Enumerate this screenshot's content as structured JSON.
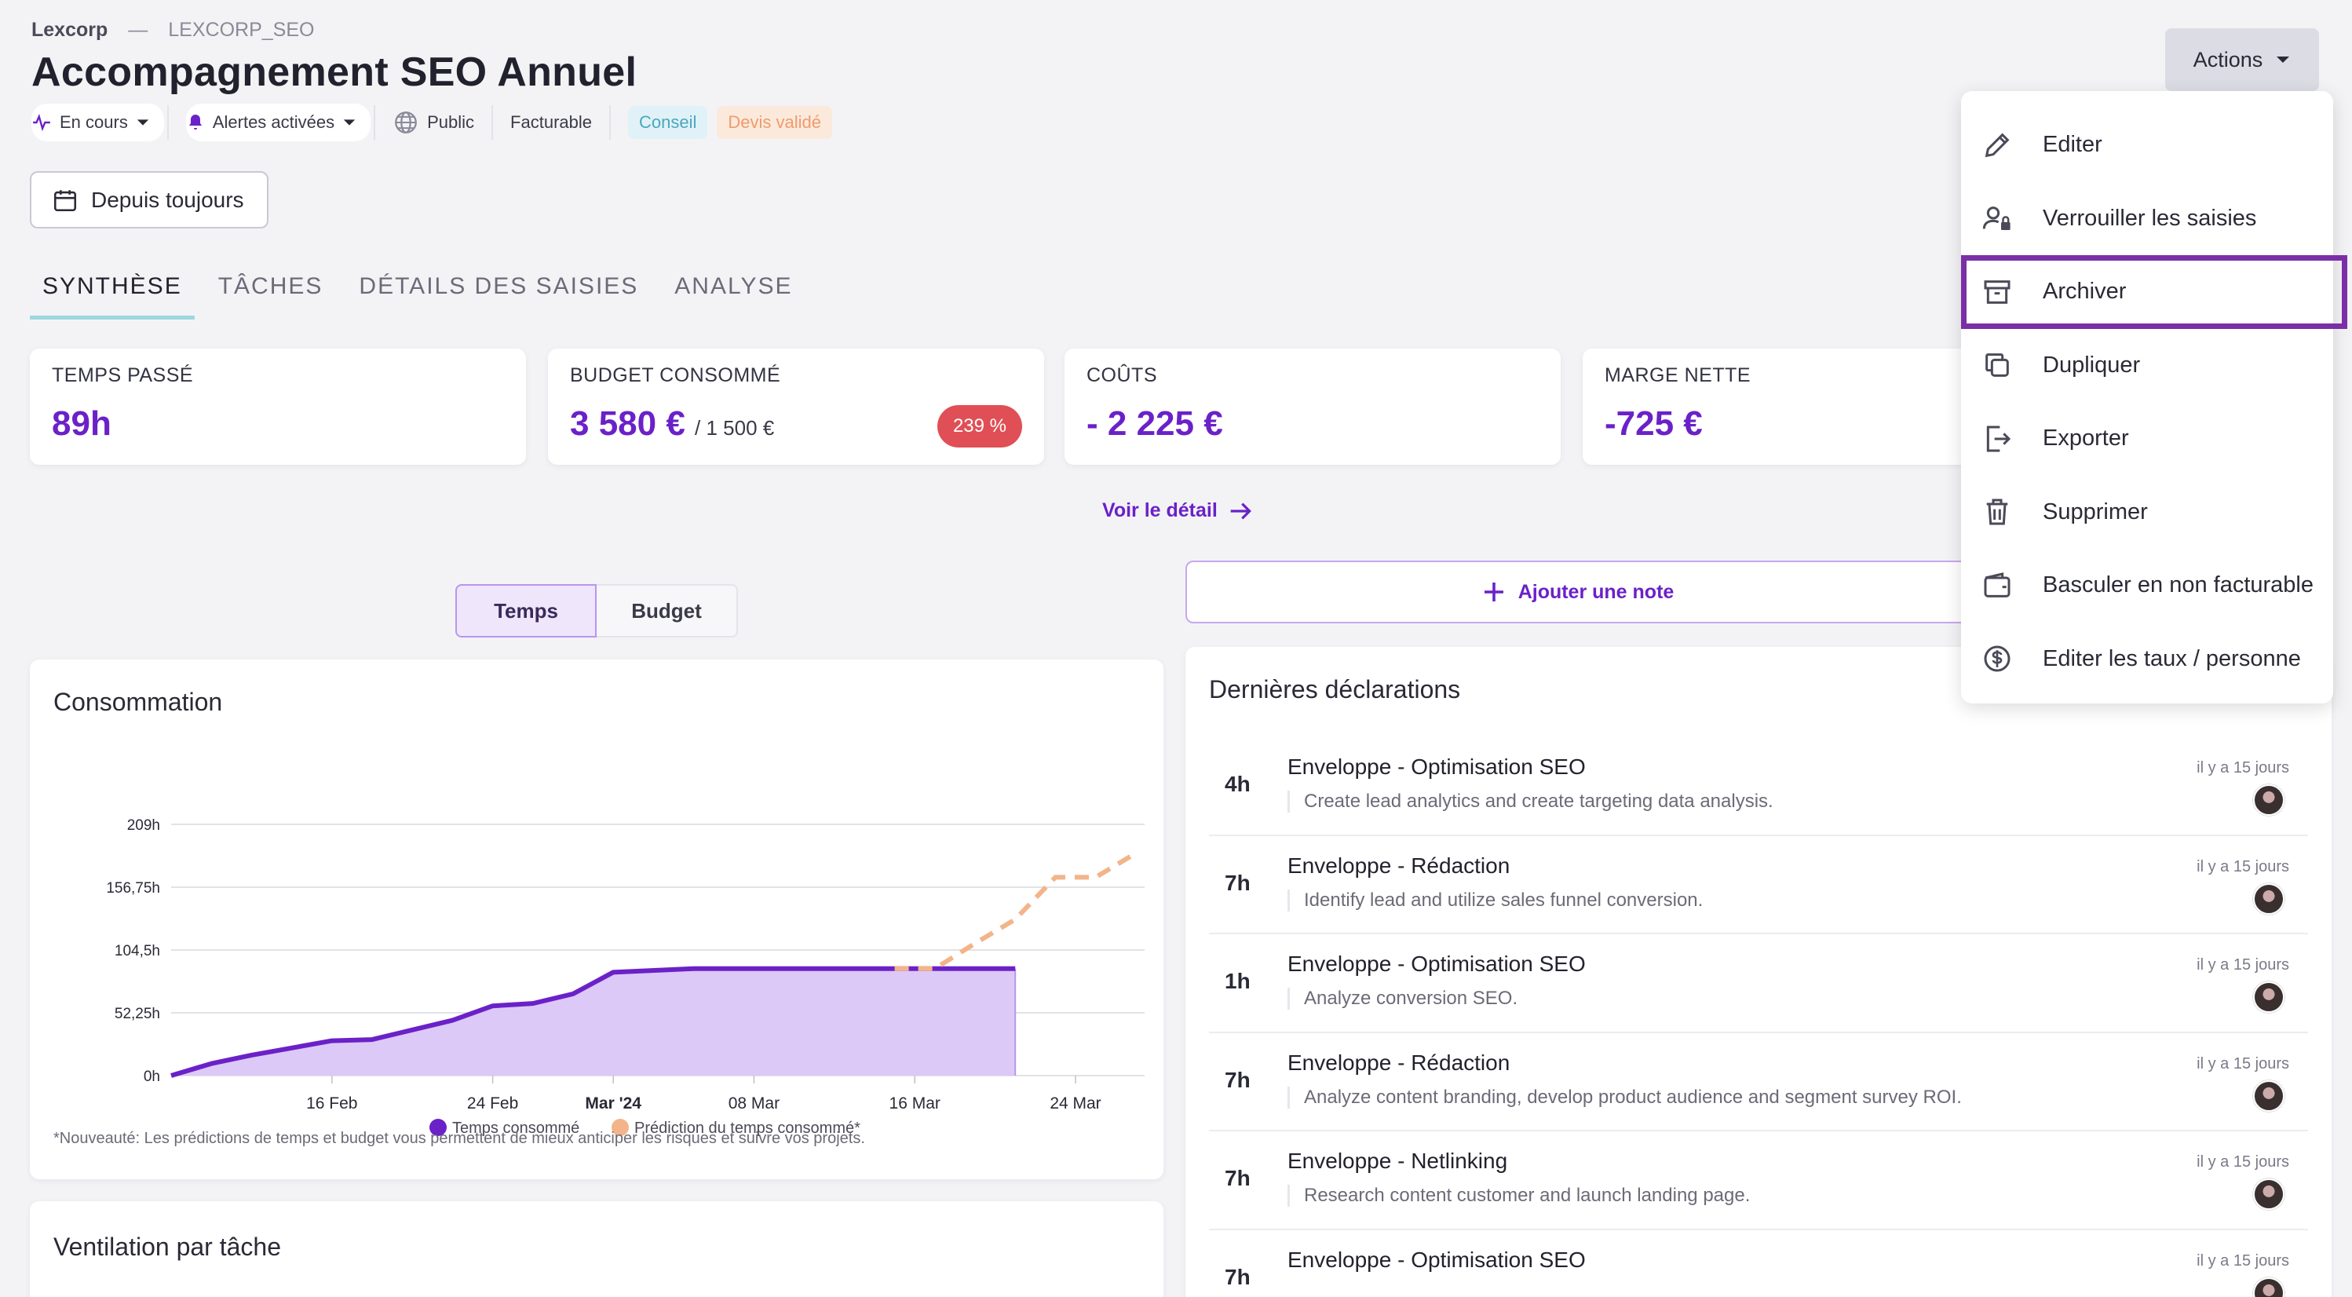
{
  "breadcrumb": {
    "org": "Lexcorp",
    "separator": "—",
    "code": "LEXCORP_SEO"
  },
  "page_title": "Accompagnement SEO Annuel",
  "meta": {
    "status": "En cours",
    "alerts": "Alertes activées",
    "visibility": "Public",
    "billing": "Facturable",
    "tags": [
      "Conseil",
      "Devis validé"
    ]
  },
  "date_filter": "Depuis toujours",
  "tabs": [
    "SYNTHÈSE",
    "TÂCHES",
    "DÉTAILS DES SAISIES",
    "ANALYSE"
  ],
  "kpis": [
    {
      "label": "TEMPS PASSÉ",
      "value": "89h"
    },
    {
      "label": "BUDGET CONSOMMÉ",
      "value": "3 580 €",
      "sub": "/ 1 500 €",
      "badge": "239 %"
    },
    {
      "label": "COÛTS",
      "value": "- 2 225 €"
    },
    {
      "label": "MARGE NETTE",
      "value": "-725 €"
    }
  ],
  "detail_link": "Voir le détail",
  "segment": {
    "left": "Temps",
    "right": "Budget"
  },
  "add_note": "Ajouter une note",
  "consumption": {
    "title": "Consommation",
    "footnote": "*Nouveauté: Les prédictions de temps et budget vous permettent de mieux anticiper les risques et suivre vos projets."
  },
  "ventilation_title": "Ventilation par tâche",
  "declarations": {
    "title": "Dernières déclarations",
    "rows": [
      {
        "hours": "4h",
        "task": "Enveloppe - Optimisation SEO",
        "desc": "Create lead analytics and create targeting data analysis.",
        "when": "il y a 15 jours"
      },
      {
        "hours": "7h",
        "task": "Enveloppe - Rédaction",
        "desc": "Identify lead and utilize sales funnel conversion.",
        "when": "il y a 15 jours"
      },
      {
        "hours": "1h",
        "task": "Enveloppe - Optimisation SEO",
        "desc": "Analyze conversion SEO.",
        "when": "il y a 15 jours"
      },
      {
        "hours": "7h",
        "task": "Enveloppe - Rédaction",
        "desc": "Analyze content branding, develop product audience and segment survey ROI.",
        "when": "il y a 15 jours"
      },
      {
        "hours": "7h",
        "task": "Enveloppe - Netlinking",
        "desc": "Research content customer and launch landing page.",
        "when": "il y a 15 jours"
      },
      {
        "hours": "7h",
        "task": "Enveloppe - Optimisation SEO",
        "desc": "",
        "when": "il y a 15 jours"
      }
    ]
  },
  "actions": {
    "button": "Actions",
    "items": [
      {
        "label": "Editer",
        "icon": "pencil-icon"
      },
      {
        "label": "Verrouiller les saisies",
        "icon": "user-lock-icon"
      },
      {
        "label": "Archiver",
        "icon": "archive-icon",
        "highlighted": true
      },
      {
        "label": "Dupliquer",
        "icon": "duplicate-icon"
      },
      {
        "label": "Exporter",
        "icon": "export-icon"
      },
      {
        "label": "Supprimer",
        "icon": "trash-icon"
      },
      {
        "label": "Basculer en non facturable",
        "icon": "wallet-icon"
      },
      {
        "label": "Editer les taux / personne",
        "icon": "dollar-circle-icon"
      }
    ]
  },
  "colors": {
    "accent": "#6b21c8",
    "prediction": "#f3b48a",
    "area": "#dcc9f7",
    "badge": "#e04f55"
  },
  "chart_data": {
    "type": "area",
    "title": "",
    "xlabel": "",
    "ylabel": "",
    "ylim": [
      0,
      209
    ],
    "y_ticks": [
      "0h",
      "52,25h",
      "104,5h",
      "156,75h",
      "209h"
    ],
    "x_ticks": [
      "16 Feb",
      "24 Feb",
      "Mar '24",
      "08 Mar",
      "16 Mar",
      "24 Mar"
    ],
    "legend": [
      "Temps consommé",
      "Prédiction du temps consommé*"
    ],
    "legend_position": "bottom",
    "series": [
      {
        "name": "Temps consommé",
        "x": [
          "2024-02-08",
          "2024-02-10",
          "2024-02-12",
          "2024-02-14",
          "2024-02-16",
          "2024-02-18",
          "2024-02-20",
          "2024-02-22",
          "2024-02-24",
          "2024-02-26",
          "2024-02-28",
          "2024-03-01",
          "2024-03-05",
          "2024-03-10",
          "2024-03-16",
          "2024-03-20",
          "2024-03-21"
        ],
        "values": [
          0,
          10,
          17,
          23,
          29,
          30,
          38,
          46,
          58,
          60,
          68,
          86,
          89,
          89,
          89,
          89,
          89
        ]
      },
      {
        "name": "Prédiction du temps consommé*",
        "x": [
          "2024-03-15",
          "2024-03-17",
          "2024-03-19",
          "2024-03-21",
          "2024-03-23",
          "2024-03-25",
          "2024-03-27"
        ],
        "values": [
          89,
          89,
          110,
          130,
          165,
          165,
          185
        ]
      }
    ],
    "grid": true
  }
}
